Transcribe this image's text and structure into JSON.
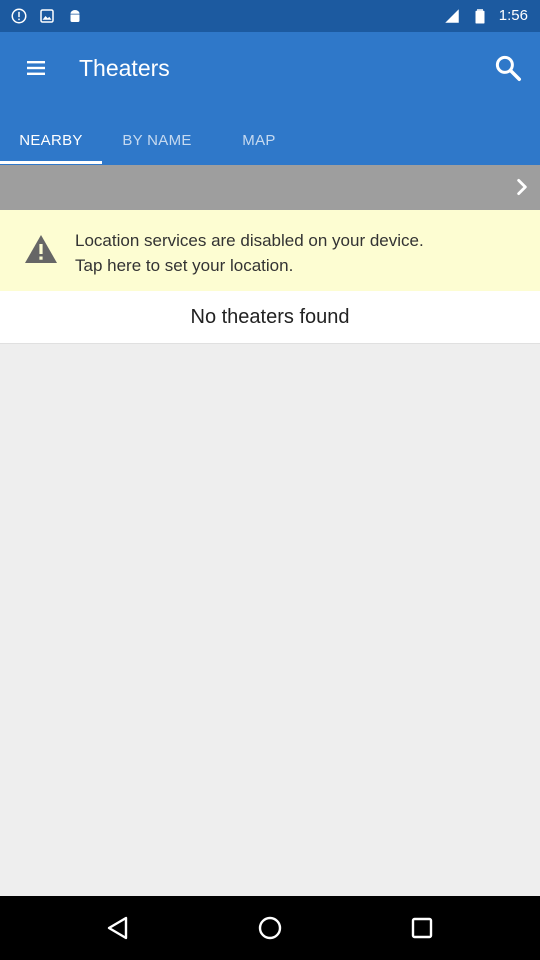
{
  "status_bar": {
    "time": "1:56",
    "left_icons": [
      "alert-circle-icon",
      "image-icon",
      "android-icon"
    ],
    "right_icons": [
      "signal-icon",
      "battery-icon"
    ]
  },
  "app_bar": {
    "title": "Theaters",
    "menu_icon": "hamburger-menu-icon",
    "search_icon": "search-icon",
    "background": "#2f78c9"
  },
  "tabs": [
    {
      "label": "NEARBY",
      "active": true
    },
    {
      "label": "BY NAME",
      "active": false
    },
    {
      "label": "MAP",
      "active": false
    }
  ],
  "location_bar": {
    "icon": "chevron-right-icon"
  },
  "warning": {
    "icon": "warning-icon",
    "line1": "Location services are disabled on your device.",
    "line2": "Tap here to set your location."
  },
  "empty_state": {
    "message": "No theaters found"
  },
  "nav_bar": {
    "buttons": [
      "back-icon",
      "home-icon",
      "recents-icon"
    ]
  }
}
